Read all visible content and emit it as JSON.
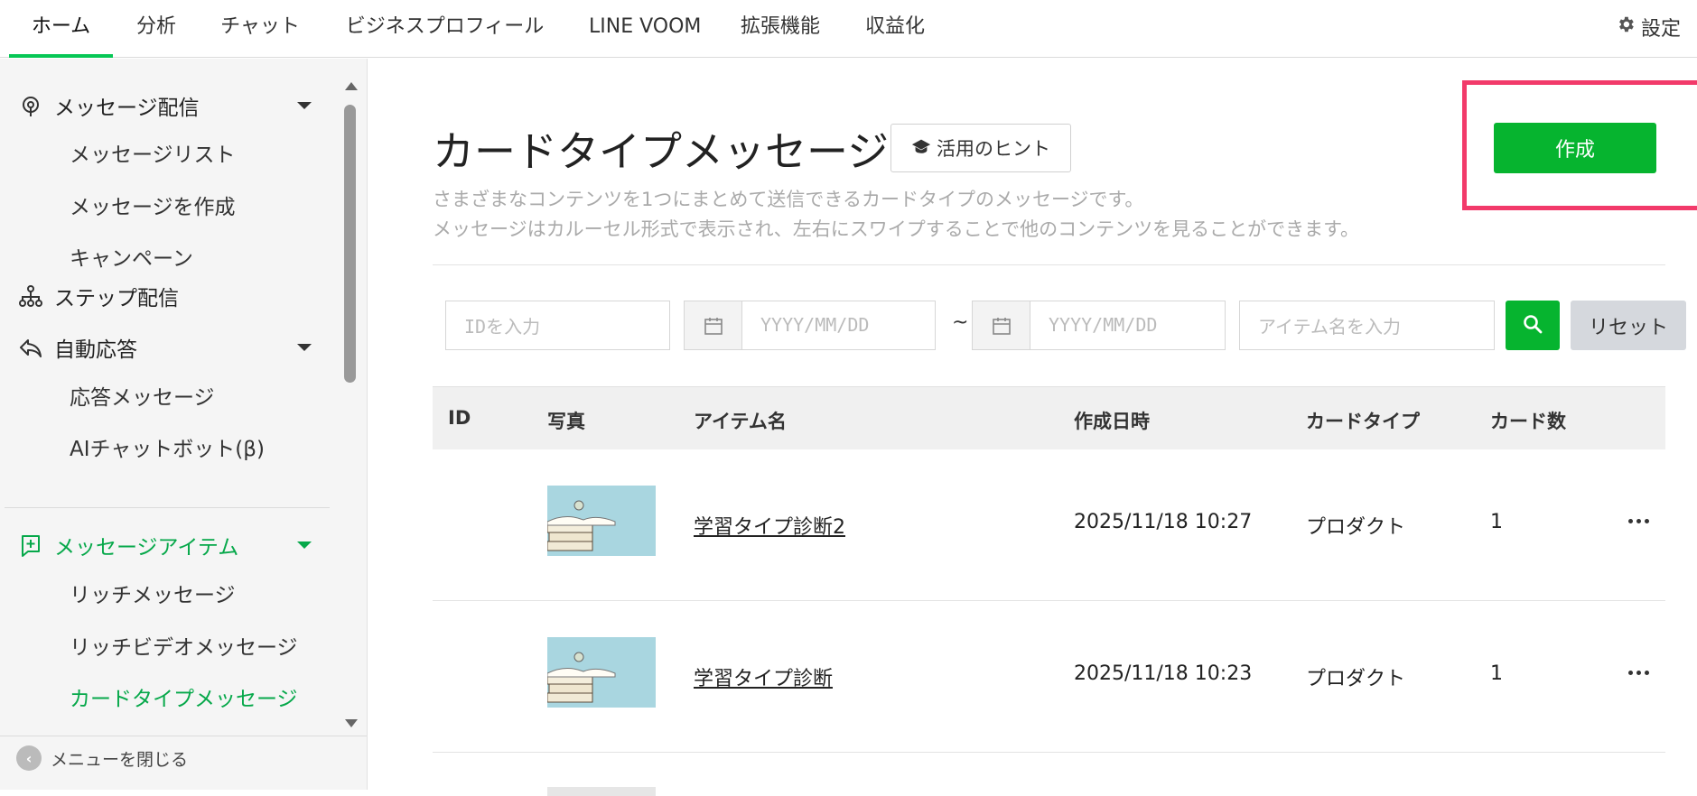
{
  "topnav": {
    "tabs": [
      {
        "label": "ホーム"
      },
      {
        "label": "分析"
      },
      {
        "label": "チャット"
      },
      {
        "label": "ビジネスプロフィール"
      },
      {
        "label": "LINE VOOM"
      },
      {
        "label": "拡張機能"
      },
      {
        "label": "収益化"
      }
    ],
    "active_tab": "ホーム",
    "settings_label": "設定",
    "settings_icon": "gear-icon"
  },
  "sidebar": {
    "groups": [
      {
        "label": "メッセージ配信",
        "icon": "broadcast-icon",
        "expanded": true,
        "items": [
          "メッセージリスト",
          "メッセージを作成",
          "キャンペーン"
        ]
      },
      {
        "label": "ステップ配信",
        "icon": "hierarchy-icon"
      },
      {
        "label": "自動応答",
        "icon": "reply-icon",
        "expanded": true,
        "items": [
          "応答メッセージ",
          "AIチャットボット(β)"
        ]
      },
      {
        "label": "メッセージアイテム",
        "icon": "add-box-icon",
        "expanded": true,
        "active": true,
        "items": [
          "リッチメッセージ",
          "リッチビデオメッセージ",
          "カードタイプメッセージ"
        ]
      }
    ],
    "active_item": "カードタイプメッセージ",
    "close_menu_label": "メニューを閉じる"
  },
  "main": {
    "title": "カードタイプメッセージ",
    "hint_button": "活用のヒント",
    "description": [
      "さまざまなコンテンツを1つにまとめて送信できるカードタイプのメッセージです。",
      "メッセージはカルーセル形式で表示され、左右にスワイプすることで他のコンテンツを見ることができます。"
    ],
    "create_button": "作成"
  },
  "filters": {
    "id_placeholder": "IDを入力",
    "date_from_placeholder": "YYYY/MM/DD",
    "date_separator": "~",
    "date_to_placeholder": "YYYY/MM/DD",
    "item_name_placeholder": "アイテム名を入力",
    "reset_label": "リセット"
  },
  "table": {
    "columns": [
      "ID",
      "写真",
      "アイテム名",
      "作成日時",
      "カードタイプ",
      "カード数"
    ],
    "rows": [
      {
        "id": "",
        "name": "学習タイプ診断2",
        "created": "2025/11/18 10:27",
        "card_type": "プロダクト",
        "card_count": "1"
      },
      {
        "id": "",
        "name": "学習タイプ診断",
        "created": "2025/11/18 10:23",
        "card_type": "プロダクト",
        "card_count": "1"
      }
    ]
  },
  "colors": {
    "accent_green": "#06b42f",
    "highlight_pink": "#f23a6a",
    "active_text_green": "#06a84a"
  }
}
